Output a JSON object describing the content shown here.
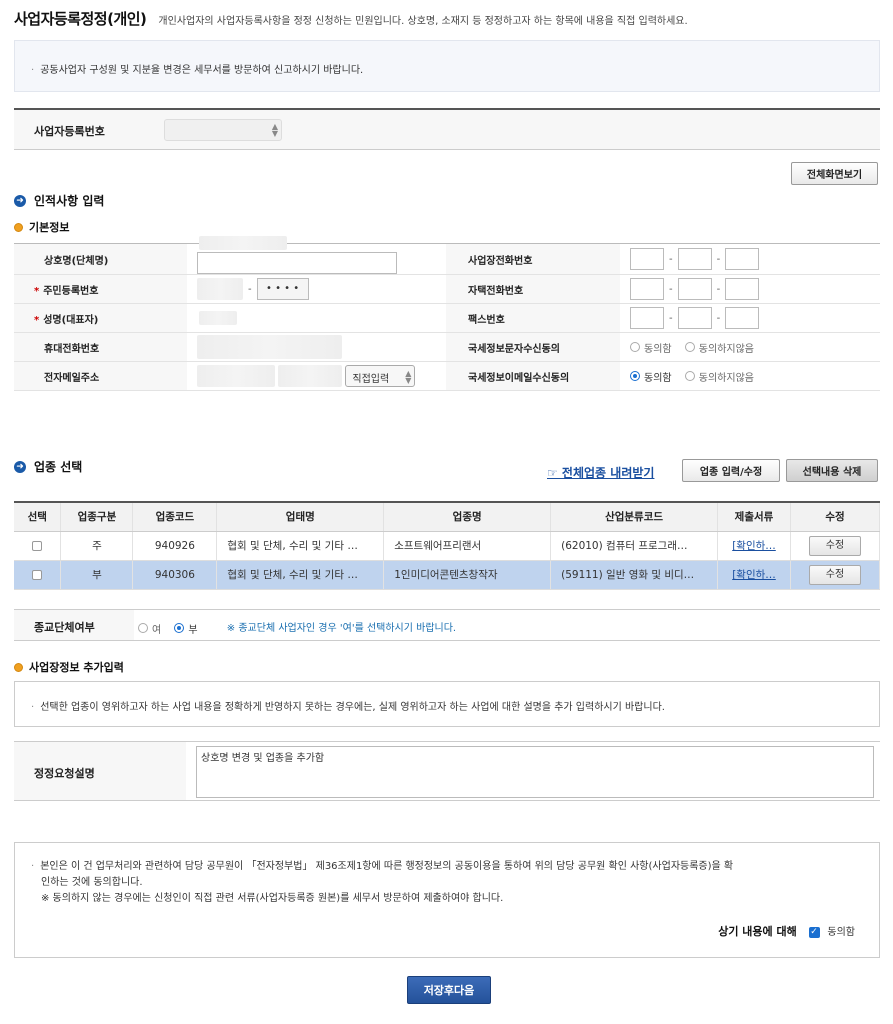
{
  "header": {
    "title": "사업자등록정정(개인)",
    "desc": "개인사업자의 사업자등록사항을 정정 신청하는 민원입니다. 상호명, 소재지 등 정정하고자 하는 항목에 내용을 직접 입력하세요."
  },
  "notice1": "공동사업자 구성원 및 지분율 변경은 세무서를 방문하여 신고하시기 바랍니다.",
  "reg": {
    "label": "사업자등록번호"
  },
  "full_view_btn": "전체화면보기",
  "personal": {
    "section_title": "인적사항 입력",
    "sub_title": "기본정보",
    "labels": {
      "company": "상호명(단체명)",
      "jumin": "주민등록번호",
      "name": "성명(대표자)",
      "mobile": "휴대전화번호",
      "email": "전자메일주소",
      "biz_phone": "사업장전화번호",
      "home_phone": "자택전화번호",
      "fax": "팩스번호",
      "sms_consent": "국세정보문자수신동의",
      "email_consent": "국세정보이메일수신동의"
    },
    "jumin_mask": "• • • •",
    "email_select": "직접입력",
    "agree": "동의함",
    "disagree": "동의하지않음"
  },
  "industry": {
    "section_title": "업종 선택",
    "download_link": "☞ 전체업종 내려받기",
    "btn_input": "업종 입력/수정",
    "btn_delete": "선택내용 삭제",
    "columns": [
      "선택",
      "업종구분",
      "업종코드",
      "업태명",
      "업종명",
      "산업분류코드",
      "제출서류",
      "수정"
    ],
    "rows": [
      {
        "type": "주",
        "code": "940926",
        "biz": "협회 및 단체, 수리 및 기타 …",
        "name": "소프트웨어프리랜서",
        "class": "(62010) 컴퓨터 프로그래…",
        "doc": "[확인하…",
        "edit": "수정"
      },
      {
        "type": "부",
        "code": "940306",
        "biz": "협회 및 단체, 수리 및 기타 …",
        "name": "1인미디어콘텐츠창작자",
        "class": "(59111) 일반 영화 및 비디…",
        "doc": "[확인하…",
        "edit": "수정"
      }
    ]
  },
  "religion": {
    "label": "종교단체여부",
    "yes": "여",
    "no": "부",
    "note": "※ 종교단체 사업자인 경우 '여'를 선택하시기 바랍니다."
  },
  "extra": {
    "sub_title": "사업장정보 추가입력",
    "notice": "선택한 업종이 영위하고자 하는 사업 내용을 정확하게 반영하지 못하는 경우에는, 실제 영위하고자 하는 사업에 대한 설명을 추가 입력하시기 바랍니다.",
    "req_label": "정정요청설명",
    "req_value": "상호명 변경 및 업종을 추가함"
  },
  "consent": {
    "line1": "본인은 이 건 업무처리와 관련하여 담당 공무원이 「전자정부법」 제36조제1항에 따른 행정정보의 공동이용을 통하여 위의 담당 공무원 확인 사항(사업자등록증)을 확",
    "line2": "인하는 것에 동의합니다.",
    "line3": "※ 동의하지 않는 경우에는 신청인이 직접 관련 서류(사업자등록증 원본)를 세무서 방문하여 제출하여야 합니다.",
    "foot_label": "상기 내용에 대해",
    "foot_agree": "동의함"
  },
  "save_btn": "저장후다음"
}
